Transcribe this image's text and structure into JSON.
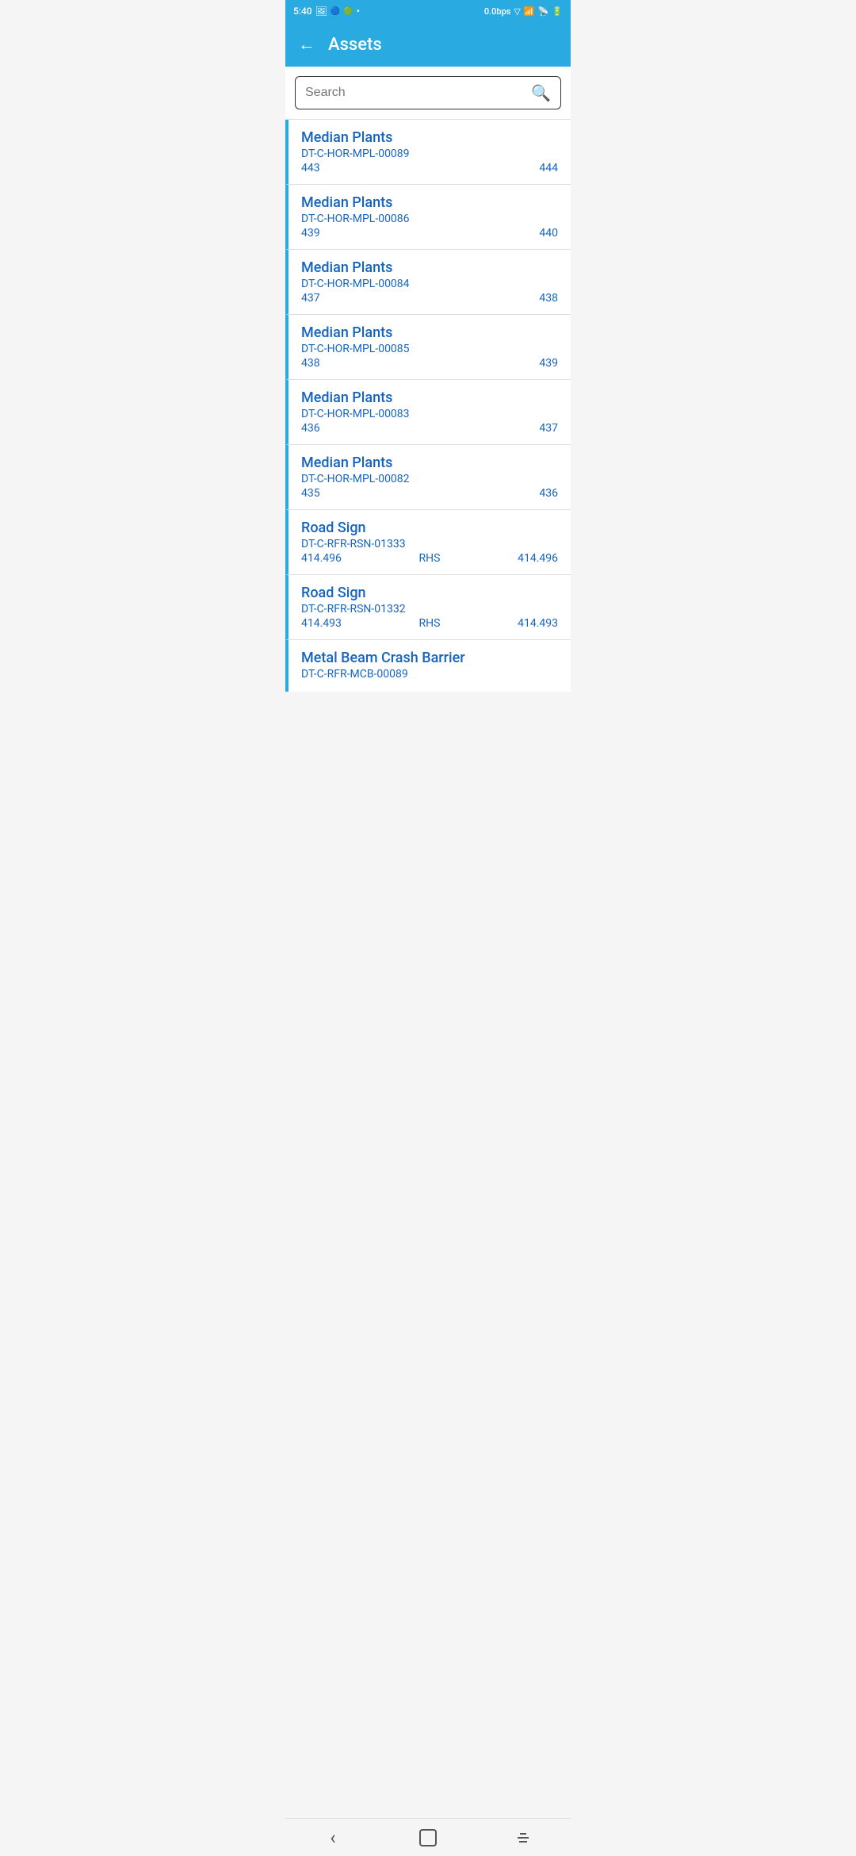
{
  "statusBar": {
    "time": "5:40",
    "network": "0.0bps",
    "wifi": "WiFi",
    "signal": "signal",
    "battery": "battery"
  },
  "appBar": {
    "title": "Assets",
    "backLabel": "←"
  },
  "search": {
    "placeholder": "Search"
  },
  "assets": [
    {
      "title": "Median Plants",
      "code": "DT-C-HOR-MPL-00089",
      "numLeft": "443",
      "numMiddle": "",
      "numRight": "444"
    },
    {
      "title": "Median Plants",
      "code": "DT-C-HOR-MPL-00086",
      "numLeft": "439",
      "numMiddle": "",
      "numRight": "440"
    },
    {
      "title": "Median Plants",
      "code": "DT-C-HOR-MPL-00084",
      "numLeft": "437",
      "numMiddle": "",
      "numRight": "438"
    },
    {
      "title": "Median Plants",
      "code": "DT-C-HOR-MPL-00085",
      "numLeft": "438",
      "numMiddle": "",
      "numRight": "439"
    },
    {
      "title": "Median Plants",
      "code": "DT-C-HOR-MPL-00083",
      "numLeft": "436",
      "numMiddle": "",
      "numRight": "437"
    },
    {
      "title": "Median Plants",
      "code": "DT-C-HOR-MPL-00082",
      "numLeft": "435",
      "numMiddle": "",
      "numRight": "436"
    },
    {
      "title": "Road Sign",
      "code": "DT-C-RFR-RSN-01333",
      "numLeft": "414.496",
      "numMiddle": "RHS",
      "numRight": "414.496"
    },
    {
      "title": "Road Sign",
      "code": "DT-C-RFR-RSN-01332",
      "numLeft": "414.493",
      "numMiddle": "RHS",
      "numRight": "414.493"
    },
    {
      "title": "Metal Beam Crash Barrier",
      "code": "DT-C-RFR-MCB-00089",
      "numLeft": "",
      "numMiddle": "",
      "numRight": ""
    }
  ],
  "bottomNav": {
    "back": "‹",
    "home": "",
    "recents": ""
  }
}
